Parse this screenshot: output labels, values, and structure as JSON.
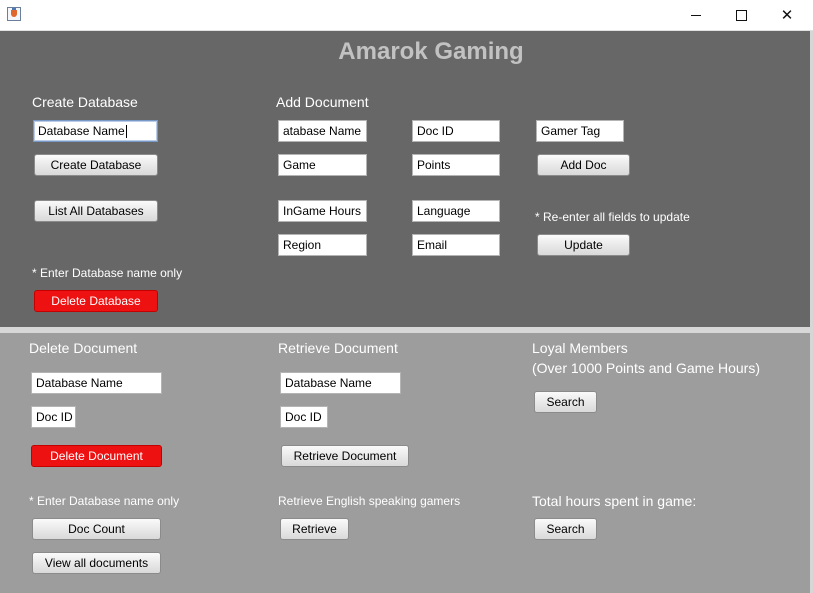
{
  "window": {
    "minimize_glyph": "",
    "maximize_glyph": "",
    "close_glyph": "✕"
  },
  "title": "Amarok Gaming",
  "colors": {
    "top_panel": "#676767",
    "bottom_panel": "#9d9d9d",
    "danger": "#ee1111"
  },
  "create_database": {
    "heading": "Create Database",
    "name_value": "Database Name",
    "create_label": "Create Database",
    "list_label": "List All Databases",
    "note": "* Enter Database name only",
    "delete_label": "Delete Database"
  },
  "add_document": {
    "heading": "Add Document",
    "fields": {
      "database_name": "atabase Name",
      "doc_id": "Doc ID",
      "gamer_tag": "Gamer Tag",
      "game": "Game",
      "points": "Points",
      "ingame_hours": "InGame Hours",
      "language": "Language",
      "region": "Region",
      "email": "Email"
    },
    "add_label": "Add Doc",
    "update_note": "* Re-enter all fields to update",
    "update_label": "Update"
  },
  "delete_document": {
    "heading": "Delete Document",
    "database_name": "Database Name",
    "doc_id": "Doc ID",
    "delete_label": "Delete Document",
    "note": "* Enter Database name only",
    "count_label": "Doc Count",
    "view_label": "View all documents"
  },
  "retrieve_document": {
    "heading": "Retrieve Document",
    "database_name": "Database Name",
    "doc_id": "Doc ID",
    "retrieve_label": "Retrieve Document",
    "english_label": "Retrieve English speaking gamers",
    "english_button": "Retrieve"
  },
  "loyal_members": {
    "heading_line1": "Loyal Members",
    "heading_line2": "(Over 1000 Points and Game Hours)",
    "search_label": "Search",
    "total_hours_label": "Total hours spent in game:",
    "total_search_label": "Search"
  }
}
